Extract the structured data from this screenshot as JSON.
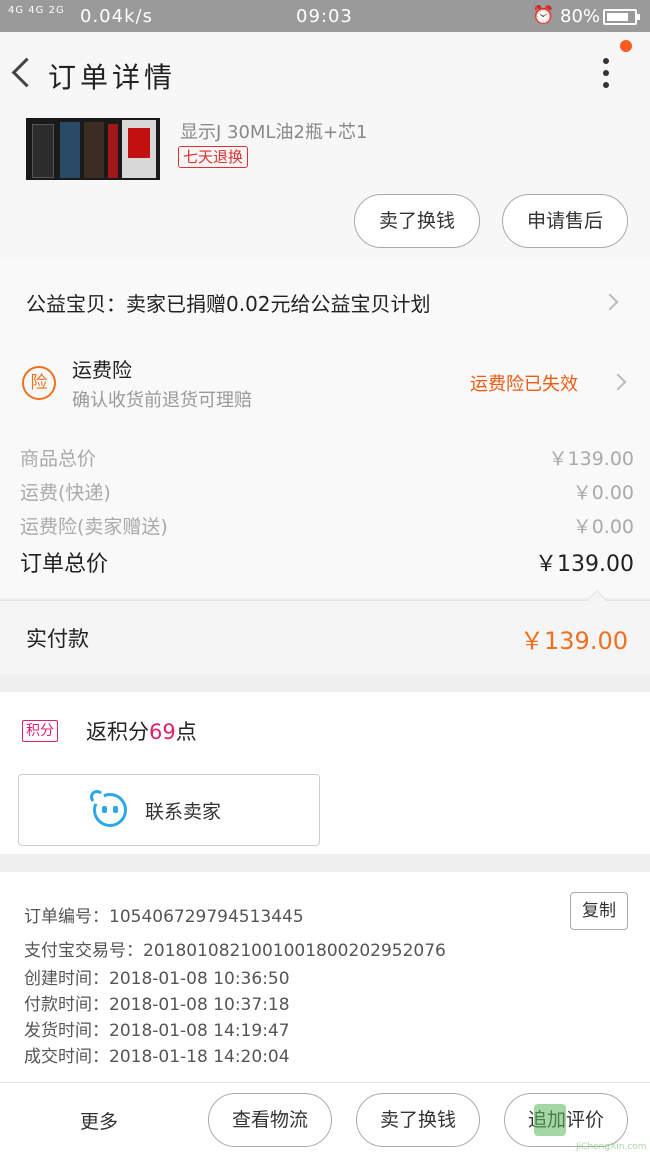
{
  "status_bar": {
    "signal": "4G 4G 2G",
    "speed": "0.04k/s",
    "time": "09:03",
    "battery": "80%",
    "battery_level": 0.8
  },
  "header": {
    "title": "订单详情"
  },
  "product": {
    "name": "显示J 30ML油2瓶+芯1",
    "tag": "七天退换",
    "buttons": {
      "refund": "卖了换钱",
      "after_sale": "申请售后"
    }
  },
  "charity": {
    "text": "公益宝贝：卖家已捐赠0.02元给公益宝贝计划"
  },
  "insurance": {
    "icon_text": "险",
    "title": "运费险",
    "subtitle": "确认收货前退货可理赔",
    "status": "运费险已失效"
  },
  "price_rows": [
    {
      "label": "商品总价",
      "value": "￥139.00"
    },
    {
      "label": "运费(快递)",
      "value": "￥0.00"
    },
    {
      "label": "运费险(卖家赠送)",
      "value": "￥0.00"
    },
    {
      "label": "订单总价",
      "value": "￥139.00"
    }
  ],
  "payment": {
    "label": "实付款",
    "value": "￥139.00"
  },
  "points": {
    "badge": "积分",
    "prefix": "返积分",
    "number": "69",
    "suffix": "点"
  },
  "contact": {
    "label": "联系卖家"
  },
  "order_info": {
    "order_no": "订单编号：105406729794513445",
    "alipay_no": "支付宝交易号：2018010821001001800202952076",
    "created": "创建时间：2018-01-08 10:36:50",
    "paid": "付款时间：2018-01-08 10:37:18",
    "shipped": "发货时间：2018-01-08 14:19:47",
    "completed": "成交时间：2018-01-18 14:20:04",
    "copy_label": "复制"
  },
  "bottom_bar": {
    "more": "更多",
    "logistics": "查看物流",
    "refund": "卖了换钱",
    "review": "追加评价"
  },
  "watermark": {
    "text": "JiChengXin.com"
  },
  "colors": {
    "accent": "#f07020",
    "points": "#e0206a",
    "link_blue": "#2aa8e8"
  }
}
